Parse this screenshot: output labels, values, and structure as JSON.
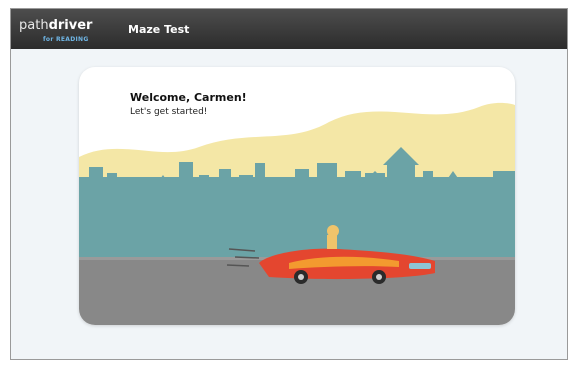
{
  "header": {
    "logo": {
      "path": "path",
      "driver": "driver",
      "tagline": "for READING"
    },
    "title": "Maze Test"
  },
  "card": {
    "welcome": "Welcome, Carmen!",
    "subtitle": "Let's get started!"
  },
  "colors": {
    "topbar": "#3a3a3a",
    "background": "#f1f5f8",
    "sky_wave": "#f4e7a6",
    "city": "#6ba3a6",
    "road": "#8a8a8a",
    "car": "#e4462f"
  }
}
